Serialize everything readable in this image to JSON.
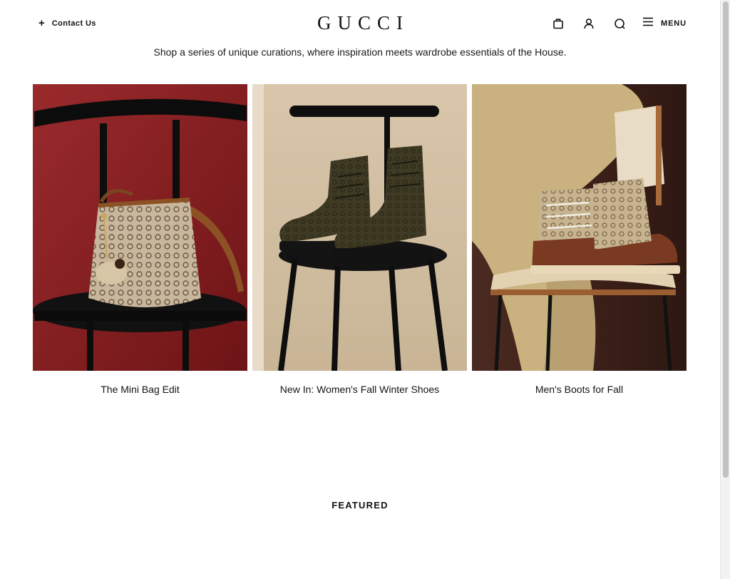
{
  "header": {
    "contact_label": "Contact Us",
    "logo_text": "GUCCI",
    "menu_label": "MENU",
    "icons": [
      "shopping-bag-icon",
      "account-icon",
      "search-icon",
      "hamburger-menu-icon"
    ]
  },
  "intro": {
    "text": "Shop a series of unique curations, where inspiration meets wardrobe essentials of the House."
  },
  "cards": [
    {
      "title": "The Mini Bag Edit",
      "image": "mini-bag-on-chair-image",
      "background_color": "#8a1f22"
    },
    {
      "title": "New In: Women's Fall Winter Shoes",
      "image": "womens-boots-on-stool-image",
      "background_color": "#d3c1a8"
    },
    {
      "title": "Men's Boots for Fall",
      "image": "mens-boots-on-chair-image",
      "background_color": "#3d211b"
    }
  ],
  "featured": {
    "heading": "FEATURED"
  }
}
